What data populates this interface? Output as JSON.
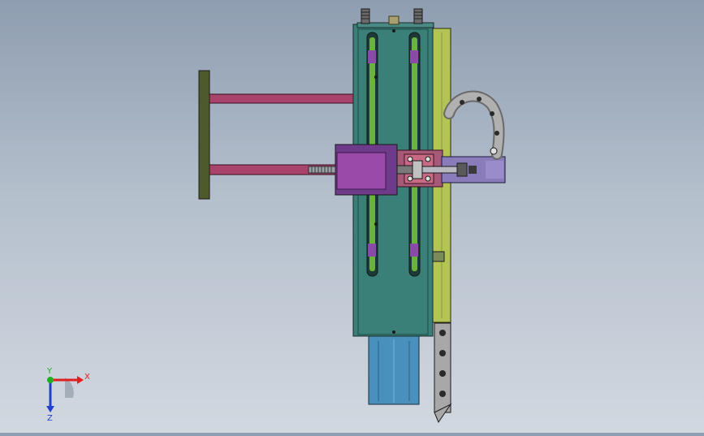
{
  "viewport": {
    "background_top": "#8e9db0",
    "background_bottom": "#d2d8e0"
  },
  "colors": {
    "mount_plate": "#4e5a2c",
    "guide_rod": "#a8446c",
    "module_body": "#3a7f78",
    "slot_rail": "#6ab43a",
    "side_rail": "#b4c454",
    "carriage": "#a65a78",
    "block": "#9a4aa8",
    "cylinder": "#8a7cba",
    "motor": "#4a90bc",
    "chain": "#9a9a9a"
  },
  "triad": {
    "x_label": "X",
    "y_label": "Y",
    "z_label": "Z",
    "x_color": "#e02020",
    "y_color": "#20b020",
    "z_color": "#2040d0"
  }
}
